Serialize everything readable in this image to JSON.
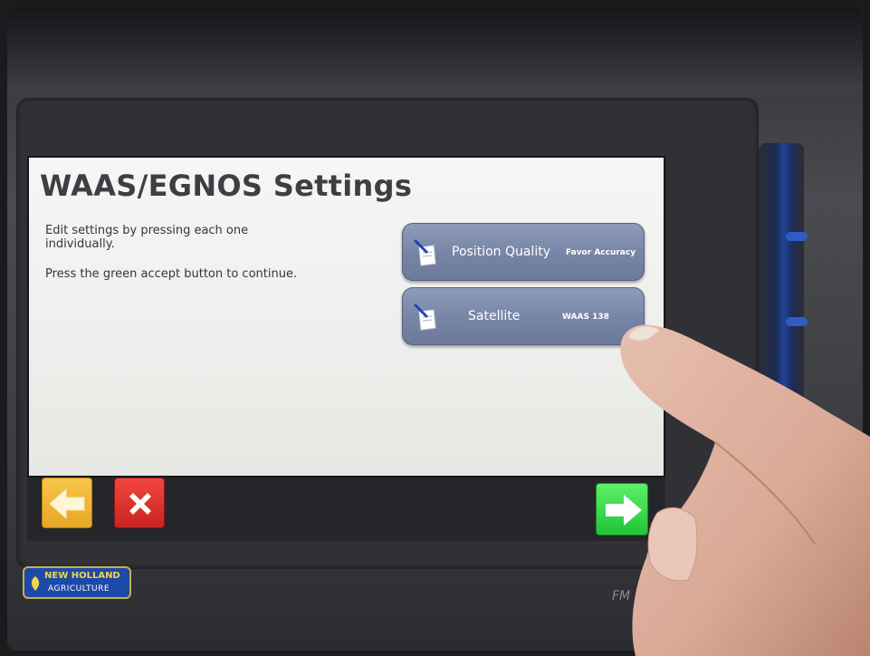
{
  "screen": {
    "title": "WAAS/EGNOS Settings",
    "instructions": [
      "Edit settings by pressing each one individually.",
      "Press the green accept button to continue."
    ]
  },
  "settings": [
    {
      "label": "Position Quality",
      "value": "Favor Accuracy",
      "icon": "edit-icon"
    },
    {
      "label": "Satellite",
      "value": "WAAS 138",
      "icon": "edit-icon"
    }
  ],
  "toolbar": {
    "back_icon": "arrow-left-icon",
    "cancel_icon": "close-icon",
    "accept_icon": "arrow-right-icon"
  },
  "device": {
    "logo_top": "NEW HOLLAND",
    "logo_bottom": "AGRICULTURE",
    "model_mark": "FM"
  },
  "colors": {
    "setting_button": "#7685a6",
    "back_button": "#f0b431",
    "cancel_button": "#e2332f",
    "accept_button": "#3fdc50",
    "title_text": "#3d3f45"
  }
}
